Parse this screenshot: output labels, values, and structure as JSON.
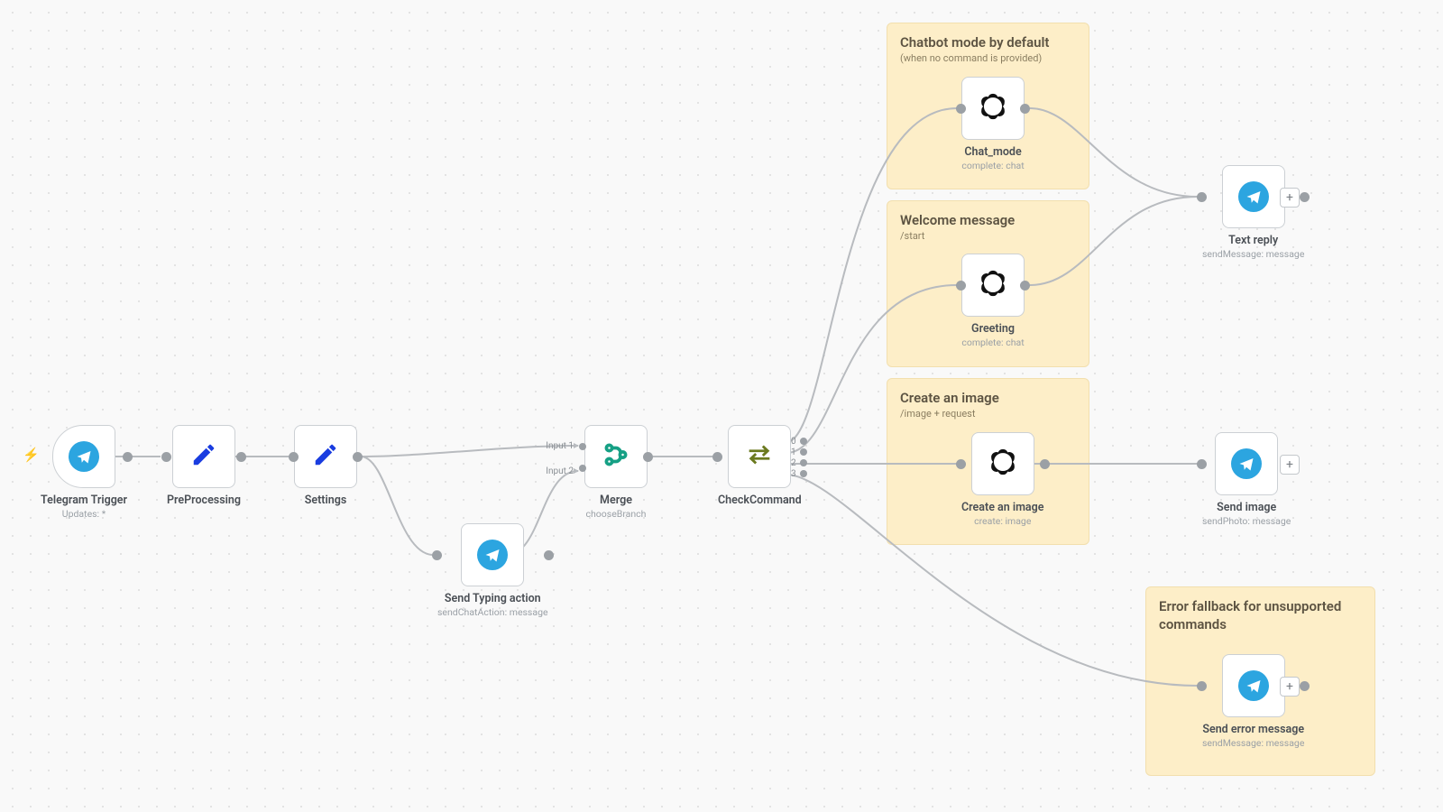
{
  "stickies": {
    "chatmode": {
      "title": "Chatbot mode by default",
      "sub": "(when no command is provided)"
    },
    "welcome": {
      "title": "Welcome message",
      "sub": "/start"
    },
    "image": {
      "title": "Create an image",
      "sub": "/image + request"
    },
    "error": {
      "title": "Error fallback for unsupported commands",
      "sub": ""
    }
  },
  "nodes": {
    "trigger": {
      "title": "Telegram Trigger",
      "sub": "Updates: *"
    },
    "preproc": {
      "title": "PreProcessing",
      "sub": ""
    },
    "settings": {
      "title": "Settings",
      "sub": ""
    },
    "typing": {
      "title": "Send Typing action",
      "sub": "sendChatAction: message"
    },
    "merge": {
      "title": "Merge",
      "sub": "chooseBranch",
      "in1": "Input 1",
      "in2": "Input 2"
    },
    "check": {
      "title": "CheckCommand",
      "sub": "",
      "p0": "0",
      "p1": "1",
      "p2": "2",
      "p3": "3"
    },
    "chatmode": {
      "title": "Chat_mode",
      "sub": "complete: chat"
    },
    "greeting": {
      "title": "Greeting",
      "sub": "complete: chat"
    },
    "createimg": {
      "title": "Create an image",
      "sub": "create: image"
    },
    "textreply": {
      "title": "Text reply",
      "sub": "sendMessage: message"
    },
    "sendimg": {
      "title": "Send image",
      "sub": "sendPhoto: message"
    },
    "senderr": {
      "title": "Send error message",
      "sub": "sendMessage: message"
    }
  },
  "plus_label": "+"
}
